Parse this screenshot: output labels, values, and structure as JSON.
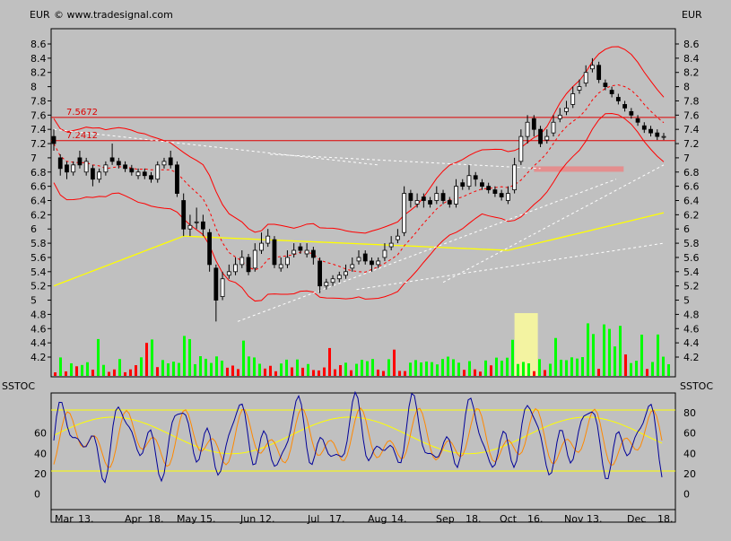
{
  "header": {
    "currency_left": "EUR",
    "currency_right": "EUR",
    "copyright": "© www.tradesignal.com"
  },
  "colors": {
    "background": "#c0c0c0",
    "frame": "#000000",
    "up_candle": "#00dd00",
    "down_candle": "#dd0000",
    "bollinger": "#ff0000",
    "moving_average_long": "#ffff00",
    "moving_average_short": "#ff0000",
    "trendline": "#ffffff",
    "resistance": "#dd0000",
    "highlight_zone": "#ffff99",
    "volume_up": "#00ff00",
    "volume_down": "#ff0000",
    "stoch_k": "#000099",
    "stoch_d": "#ff8800",
    "stoch_levels": "#ffff00"
  },
  "price_panel": {
    "y_axis_ticks": [
      "8.6",
      "8.4",
      "8.2",
      "8",
      "7.8",
      "7.6",
      "7.4",
      "7.2",
      "7",
      "6.8",
      "6.6",
      "6.4",
      "6.2",
      "6",
      "5.8",
      "5.6",
      "5.4",
      "5.2",
      "5",
      "4.8",
      "4.6",
      "4.4",
      "4.2"
    ],
    "ylim": [
      4.0,
      8.75
    ],
    "hlines": [
      {
        "label": "7.5672",
        "value": 7.5672
      },
      {
        "label": "7.2412",
        "value": 7.2412
      }
    ]
  },
  "stoch_panel": {
    "title_left": "SSTOC",
    "title_right": "SSTOC",
    "y_axis_ticks_left": [
      "60",
      "40",
      "20",
      "0"
    ],
    "y_axis_ticks_right": [
      "80",
      "60",
      "40",
      "20",
      "0"
    ],
    "levels": [
      80,
      20
    ],
    "ylim": [
      -5,
      100
    ]
  },
  "x_axis": {
    "labels": [
      "Mar",
      "13.",
      "Apr",
      "18.",
      "May",
      "15.",
      "Jun",
      "12.",
      "Jul",
      "17.",
      "Aug",
      "14.",
      "Sep",
      "18.",
      "Oct",
      "16.",
      "Nov",
      "13.",
      "Dec",
      "18."
    ]
  },
  "chart_data": {
    "type": "candlestick",
    "x": [
      0,
      3,
      6,
      9,
      12,
      15,
      18,
      21,
      24,
      27,
      30,
      33,
      36,
      39,
      42,
      45,
      48,
      51,
      54,
      57,
      60,
      63,
      66,
      69,
      72,
      75,
      78,
      81,
      84,
      87,
      90,
      93,
      96,
      99,
      102,
      105,
      108,
      111,
      114,
      117,
      120,
      123,
      126,
      129,
      132,
      135,
      138,
      141,
      144,
      147,
      150,
      153,
      156,
      159,
      162,
      165,
      168,
      171,
      174,
      177,
      180,
      183,
      186,
      189,
      192,
      195,
      198,
      201,
      204,
      207,
      210,
      213,
      216,
      219,
      222,
      225,
      228,
      231,
      234,
      237,
      240,
      243,
      246,
      249,
      252,
      255,
      258,
      261,
      264,
      267,
      270,
      273,
      276,
      279,
      282
    ],
    "close": [
      7.2,
      6.85,
      6.8,
      6.9,
      6.9,
      6.95,
      6.7,
      6.8,
      6.9,
      6.95,
      6.9,
      6.85,
      6.8,
      6.8,
      6.75,
      6.7,
      6.9,
      6.95,
      6.9,
      6.5,
      6.0,
      6.05,
      6.1,
      6.0,
      5.5,
      5.0,
      5.3,
      5.4,
      5.5,
      5.6,
      5.4,
      5.7,
      5.8,
      5.9,
      5.5,
      5.5,
      5.6,
      5.7,
      5.7,
      5.7,
      5.6,
      5.2,
      5.25,
      5.3,
      5.35,
      5.4,
      5.5,
      5.6,
      5.55,
      5.5,
      5.55,
      5.7,
      5.8,
      5.9,
      6.5,
      6.4,
      6.4,
      6.4,
      6.35,
      6.5,
      6.4,
      6.35,
      6.6,
      6.6,
      6.75,
      6.7,
      6.6,
      6.55,
      6.5,
      6.45,
      6.5,
      6.9,
      7.3,
      7.5,
      7.4,
      7.2,
      7.3,
      7.5,
      7.6,
      7.7,
      7.9,
      8.0,
      8.2,
      8.3,
      8.1,
      8.0,
      7.9,
      7.8,
      7.7,
      7.6,
      7.5,
      7.4,
      7.35,
      7.3,
      7.3
    ],
    "open": [
      7.3,
      7.0,
      6.9,
      6.8,
      7.0,
      6.8,
      6.85,
      6.7,
      6.8,
      7.0,
      6.95,
      6.9,
      6.85,
      6.75,
      6.8,
      6.75,
      6.7,
      6.9,
      7.0,
      6.9,
      6.4,
      6.0,
      6.1,
      6.1,
      5.95,
      5.45,
      5.05,
      5.35,
      5.4,
      5.5,
      5.6,
      5.45,
      5.7,
      5.8,
      5.85,
      5.45,
      5.5,
      5.65,
      5.75,
      5.65,
      5.7,
      5.55,
      5.2,
      5.25,
      5.3,
      5.35,
      5.45,
      5.55,
      5.65,
      5.55,
      5.5,
      5.6,
      5.75,
      5.85,
      5.95,
      6.5,
      6.35,
      6.45,
      6.4,
      6.4,
      6.5,
      6.4,
      6.35,
      6.65,
      6.6,
      6.75,
      6.65,
      6.6,
      6.55,
      6.5,
      6.4,
      6.55,
      6.95,
      7.3,
      7.55,
      7.4,
      7.25,
      7.35,
      7.55,
      7.65,
      7.75,
      7.95,
      8.05,
      8.25,
      8.3,
      8.05,
      7.95,
      7.85,
      7.75,
      7.65,
      7.55,
      7.45,
      7.4,
      7.35,
      7.3
    ],
    "high": [
      7.4,
      7.05,
      6.95,
      6.95,
      7.1,
      7.0,
      6.9,
      6.85,
      6.95,
      7.2,
      7.0,
      6.95,
      6.9,
      6.85,
      6.85,
      6.8,
      6.95,
      7.0,
      7.1,
      6.95,
      6.5,
      6.2,
      6.3,
      6.2,
      6.0,
      5.5,
      5.4,
      5.5,
      5.6,
      5.7,
      5.65,
      5.8,
      5.95,
      6.0,
      5.9,
      5.6,
      5.7,
      5.8,
      5.8,
      5.8,
      5.75,
      5.6,
      5.3,
      5.35,
      5.4,
      5.5,
      5.6,
      5.7,
      5.7,
      5.6,
      5.6,
      5.8,
      5.9,
      6.0,
      6.6,
      6.55,
      6.5,
      6.5,
      6.45,
      6.6,
      6.55,
      6.45,
      6.7,
      6.7,
      6.9,
      6.8,
      6.7,
      6.65,
      6.6,
      6.55,
      6.6,
      7.0,
      7.4,
      7.6,
      7.6,
      7.45,
      7.4,
      7.6,
      7.7,
      7.8,
      8.0,
      8.1,
      8.3,
      8.4,
      8.35,
      8.1,
      8.0,
      7.9,
      7.8,
      7.7,
      7.6,
      7.5,
      7.45,
      7.4,
      7.35
    ],
    "low": [
      7.1,
      6.75,
      6.7,
      6.75,
      6.85,
      6.75,
      6.6,
      6.65,
      6.75,
      6.9,
      6.85,
      6.8,
      6.75,
      6.7,
      6.7,
      6.65,
      6.65,
      6.85,
      6.85,
      6.45,
      5.9,
      5.9,
      6.0,
      5.9,
      5.4,
      4.7,
      5.0,
      5.3,
      5.35,
      5.45,
      5.35,
      5.4,
      5.65,
      5.75,
      5.45,
      5.4,
      5.45,
      5.6,
      5.65,
      5.6,
      5.5,
      5.1,
      5.15,
      5.2,
      5.25,
      5.3,
      5.4,
      5.5,
      5.5,
      5.4,
      5.45,
      5.55,
      5.7,
      5.8,
      5.9,
      6.3,
      6.3,
      6.3,
      6.3,
      6.35,
      6.35,
      6.3,
      6.3,
      6.55,
      6.55,
      6.6,
      6.55,
      6.5,
      6.45,
      6.4,
      6.35,
      6.5,
      6.9,
      7.2,
      7.3,
      7.15,
      7.2,
      7.3,
      7.5,
      7.6,
      7.7,
      7.9,
      8.0,
      8.2,
      8.05,
      7.95,
      7.85,
      7.75,
      7.65,
      7.55,
      7.45,
      7.35,
      7.3,
      7.25,
      7.25
    ]
  }
}
